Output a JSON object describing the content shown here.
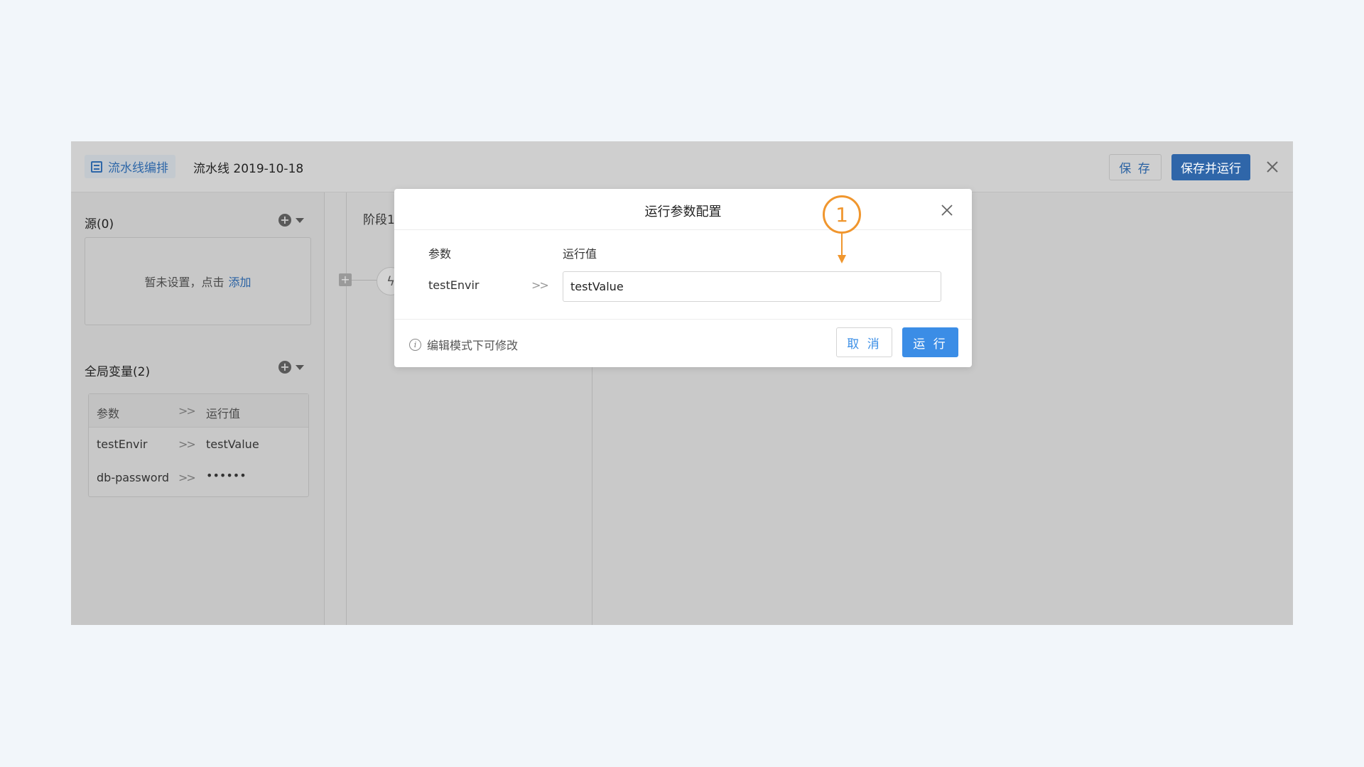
{
  "header": {
    "badge_label": "流水线编排",
    "title": "流水线 2019-10-18",
    "save_label": "保 存",
    "save_run_label": "保存并运行"
  },
  "left": {
    "source_title": "源(0)",
    "empty_text": "暂未设置，点击",
    "empty_link": "添加",
    "vars_title": "全局变量(2)",
    "table": {
      "headers": [
        "参数",
        "运行值"
      ],
      "rows": [
        {
          "name": "testEnvir",
          "value": "testValue"
        },
        {
          "name": "db-password",
          "value": "••••••"
        }
      ],
      "separator": ">>"
    }
  },
  "stage": {
    "title": "阶段1",
    "node_icon": "lightning-icon"
  },
  "modal": {
    "title": "运行参数配置",
    "col_param": "参数",
    "col_value": "运行值",
    "param_name": "testEnvir",
    "separator": ">>",
    "param_value": "testValue",
    "info_text": "编辑模式下可修改",
    "cancel_label": "取 消",
    "run_label": "运 行"
  },
  "annotation": {
    "number": "1",
    "color": "#f0962e"
  },
  "colors": {
    "primary": "#3b8de6",
    "overlay_primary": "#2f66a9",
    "page_bg": "#f2f6fa"
  }
}
